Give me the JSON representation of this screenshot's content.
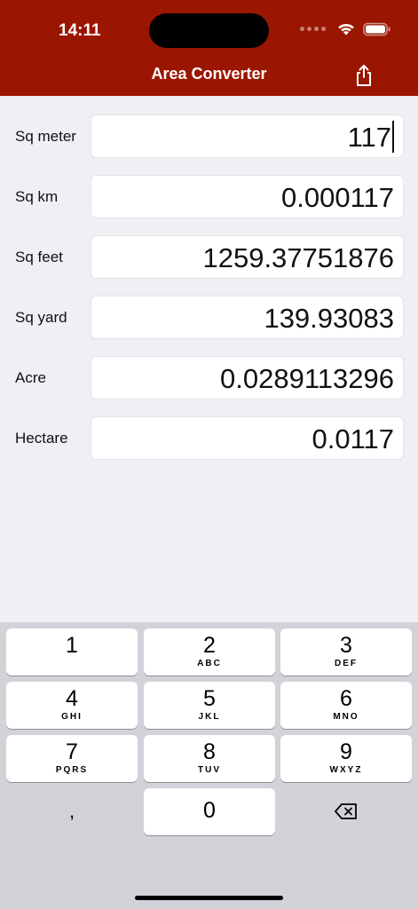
{
  "status_bar": {
    "time": "14:11"
  },
  "nav": {
    "title": "Area Converter"
  },
  "fields": [
    {
      "label": "Sq meter",
      "value": "117"
    },
    {
      "label": "Sq km",
      "value": "0.000117"
    },
    {
      "label": "Sq feet",
      "value": "1259.37751876"
    },
    {
      "label": "Sq yard",
      "value": "139.93083"
    },
    {
      "label": "Acre",
      "value": "0.0289113296"
    },
    {
      "label": "Hectare",
      "value": "0.0117"
    }
  ],
  "keyboard": {
    "keys": [
      {
        "num": "1",
        "letters": ""
      },
      {
        "num": "2",
        "letters": "ABC"
      },
      {
        "num": "3",
        "letters": "DEF"
      },
      {
        "num": "4",
        "letters": "GHI"
      },
      {
        "num": "5",
        "letters": "JKL"
      },
      {
        "num": "6",
        "letters": "MNO"
      },
      {
        "num": "7",
        "letters": "PQRS"
      },
      {
        "num": "8",
        "letters": "TUV"
      },
      {
        "num": "9",
        "letters": "WXYZ"
      }
    ],
    "comma": ",",
    "zero": "0"
  },
  "colors": {
    "header": "#9b1600",
    "background": "#efeff4",
    "keyboard": "#d1d3d9"
  },
  "icons": {
    "share": "share-icon",
    "delete": "delete-backspace-icon",
    "wifi": "wifi-icon",
    "battery": "battery-icon"
  }
}
